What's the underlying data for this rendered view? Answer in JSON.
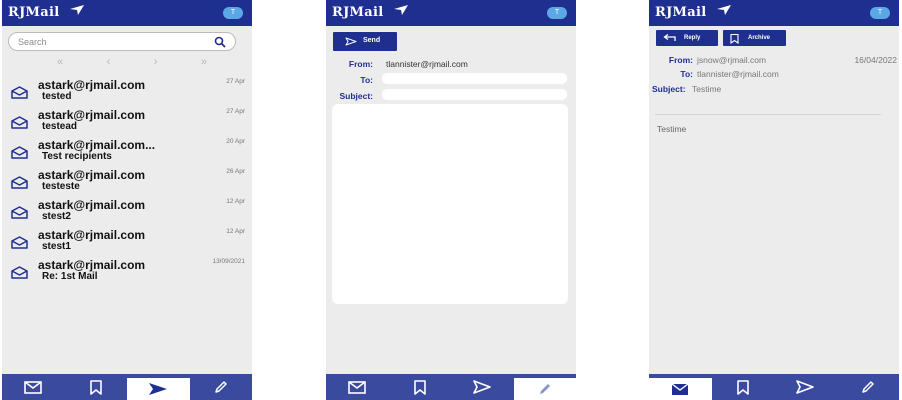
{
  "brand": {
    "logo_text": "RJMail",
    "avatar_initial": "T"
  },
  "colors": {
    "primary": "#1f2f8f",
    "bottom_bar": "#3a4a9f",
    "avatar": "#5aa9e6",
    "background": "#ececec"
  },
  "inbox": {
    "search_placeholder": "Search",
    "pager": [
      "«",
      "‹",
      "›",
      "»"
    ],
    "messages": [
      {
        "from": "astark@rjmail.com",
        "subject": "tested",
        "date": "27 Apr"
      },
      {
        "from": "astark@rjmail.com",
        "subject": "testead",
        "date": "27 Apr"
      },
      {
        "from": "astark@rjmail.com...",
        "subject": "Test recipients",
        "date": "20 Apr"
      },
      {
        "from": "astark@rjmail.com",
        "subject": "testeste",
        "date": "26 Apr"
      },
      {
        "from": "astark@rjmail.com",
        "subject": "stest2",
        "date": "12 Apr"
      },
      {
        "from": "astark@rjmail.com",
        "subject": "stest1",
        "date": "12 Apr"
      },
      {
        "from": "astark@rjmail.com",
        "subject": "Re: 1st Mail",
        "date": "13/09/2021"
      }
    ]
  },
  "compose": {
    "send_label": "Send",
    "from_label": "From:",
    "from_value": "tlannister@rjmail.com",
    "to_label": "To:",
    "subject_label": "Subject:"
  },
  "read": {
    "reply_label": "Reply",
    "archive_label": "Archive",
    "from_label": "From:",
    "from_value": "jsnow@rjmail.com",
    "to_label": "To:",
    "to_value": "tlannister@rjmail.com",
    "subject_label": "Subject:",
    "subject_value": "Testime",
    "date": "16/04/2022",
    "body": "Testime"
  },
  "bottom_nav": {
    "icons": [
      "envelope-icon",
      "bookmark-icon",
      "send-icon",
      "pencil-icon"
    ],
    "active": {
      "inbox_screen": "send-icon",
      "compose_screen": "pencil-icon",
      "read_screen": "envelope-icon"
    }
  }
}
